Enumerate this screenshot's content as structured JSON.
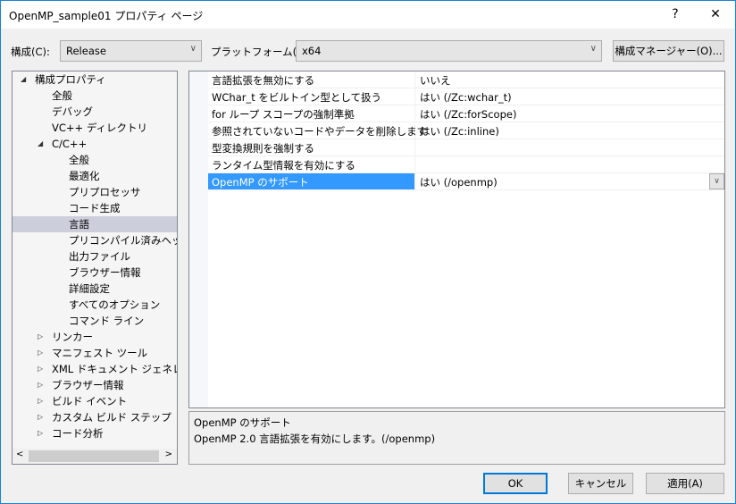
{
  "window": {
    "title": "OpenMP_sample01 プロパティ ページ",
    "help": "?",
    "close": "✕"
  },
  "toolbar": {
    "config_label": "構成(C):",
    "config_value": "Release",
    "platform_label": "プラットフォーム(P):",
    "platform_value": "x64",
    "manager_button": "構成マネージャー(O)..."
  },
  "tree": [
    {
      "label": "構成プロパティ",
      "level": 0,
      "toggle": "◢"
    },
    {
      "label": "全般",
      "level": 1
    },
    {
      "label": "デバッグ",
      "level": 1
    },
    {
      "label": "VC++ ディレクトリ",
      "level": 1
    },
    {
      "label": "C/C++",
      "level": 1,
      "toggle": "◢"
    },
    {
      "label": "全般",
      "level": 2
    },
    {
      "label": "最適化",
      "level": 2
    },
    {
      "label": "プリプロセッサ",
      "level": 2
    },
    {
      "label": "コード生成",
      "level": 2
    },
    {
      "label": "言語",
      "level": 2,
      "selected": true
    },
    {
      "label": "プリコンパイル済みヘッダー",
      "level": 2
    },
    {
      "label": "出力ファイル",
      "level": 2
    },
    {
      "label": "ブラウザー情報",
      "level": 2
    },
    {
      "label": "詳細設定",
      "level": 2
    },
    {
      "label": "すべてのオプション",
      "level": 2
    },
    {
      "label": "コマンド ライン",
      "level": 2
    },
    {
      "label": "リンカー",
      "level": 1,
      "toggle": "▷"
    },
    {
      "label": "マニフェスト ツール",
      "level": 1,
      "toggle": "▷"
    },
    {
      "label": "XML ドキュメント ジェネレーター",
      "level": 1,
      "toggle": "▷"
    },
    {
      "label": "ブラウザー情報",
      "level": 1,
      "toggle": "▷"
    },
    {
      "label": "ビルド イベント",
      "level": 1,
      "toggle": "▷"
    },
    {
      "label": "カスタム ビルド ステップ",
      "level": 1,
      "toggle": "▷"
    },
    {
      "label": "コード分析",
      "level": 1,
      "toggle": "▷"
    }
  ],
  "properties": [
    {
      "name": "言語拡張を無効にする",
      "value": "いいえ"
    },
    {
      "name": "WChar_t をビルトイン型として扱う",
      "value": "はい (/Zc:wchar_t)"
    },
    {
      "name": "for ループ スコープの強制準拠",
      "value": "はい (/Zc:forScope)"
    },
    {
      "name": "参照されていないコードやデータを削除します",
      "value": "はい (/Zc:inline)"
    },
    {
      "name": "型変換規則を強制する",
      "value": ""
    },
    {
      "name": "ランタイム型情報を有効にする",
      "value": ""
    },
    {
      "name": "OpenMP のサポート",
      "value": "はい (/openmp)",
      "selected": true
    }
  ],
  "description": {
    "title": "OpenMP のサポート",
    "text": "OpenMP 2.0 言語拡張を有効にします。(/openmp)"
  },
  "buttons": {
    "ok": "OK",
    "cancel": "キャンセル",
    "apply": "適用(A)"
  }
}
